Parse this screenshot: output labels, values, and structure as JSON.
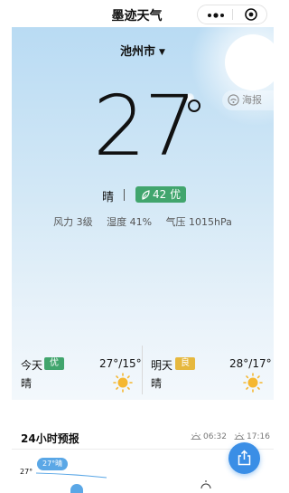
{
  "app": {
    "title": "墨迹天气"
  },
  "location": {
    "city": "池州市"
  },
  "actions": {
    "poster_label": "海报"
  },
  "current": {
    "temperature": "27",
    "condition": "晴",
    "aqi": "42 优",
    "wind": "风力 3级",
    "humidity": "湿度 41%",
    "pressure": "气压 1015hPa"
  },
  "forecast": [
    {
      "day": "今天",
      "quality": "优",
      "quality_color": "#41a56d",
      "temps": "27°/15°",
      "condition": "晴",
      "icon": "sun-icon"
    },
    {
      "day": "明天",
      "quality": "良",
      "quality_color": "#e6b83e",
      "temps": "28°/17°",
      "condition": "晴",
      "icon": "sun-icon"
    }
  ],
  "hourly": {
    "title": "24小时预报",
    "sunrise": "06:32",
    "sunset": "17:16",
    "current_temp": "27°",
    "tooltip": "27°晴"
  },
  "colors": {
    "accent": "#3a8ee6",
    "aqi_good": "#41a56d",
    "aqi_moderate": "#e6b83e"
  }
}
